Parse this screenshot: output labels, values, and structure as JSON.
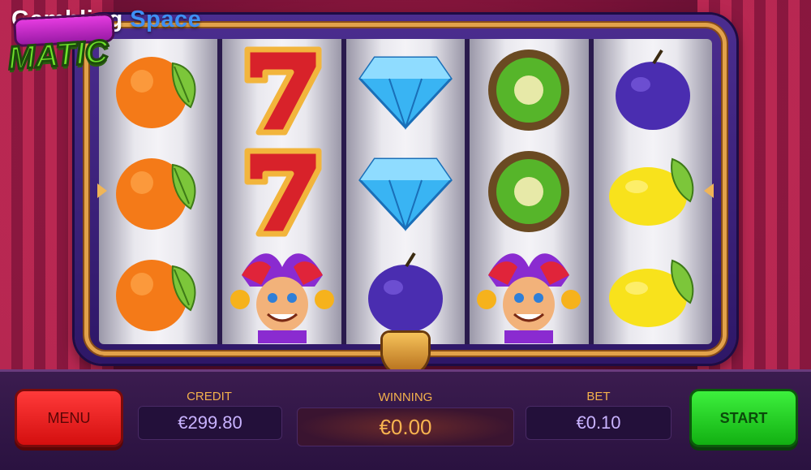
{
  "brand": {
    "word1": "Gambling",
    "word2": "Space"
  },
  "game_logo": {
    "text": "MATIC"
  },
  "reels": [
    [
      "orange",
      "orange",
      "orange"
    ],
    [
      "seven",
      "seven",
      "jester"
    ],
    [
      "diamond",
      "diamond",
      "plum"
    ],
    [
      "kiwi",
      "kiwi",
      "jester"
    ],
    [
      "plum",
      "lemon",
      "lemon"
    ]
  ],
  "controls": {
    "menu_label": "MENU",
    "start_label": "START",
    "credit_label": "CREDIT",
    "credit_value": "€299.80",
    "winning_label": "WINNING",
    "winning_value": "€0.00",
    "bet_label": "BET",
    "bet_value": "€0.10"
  }
}
